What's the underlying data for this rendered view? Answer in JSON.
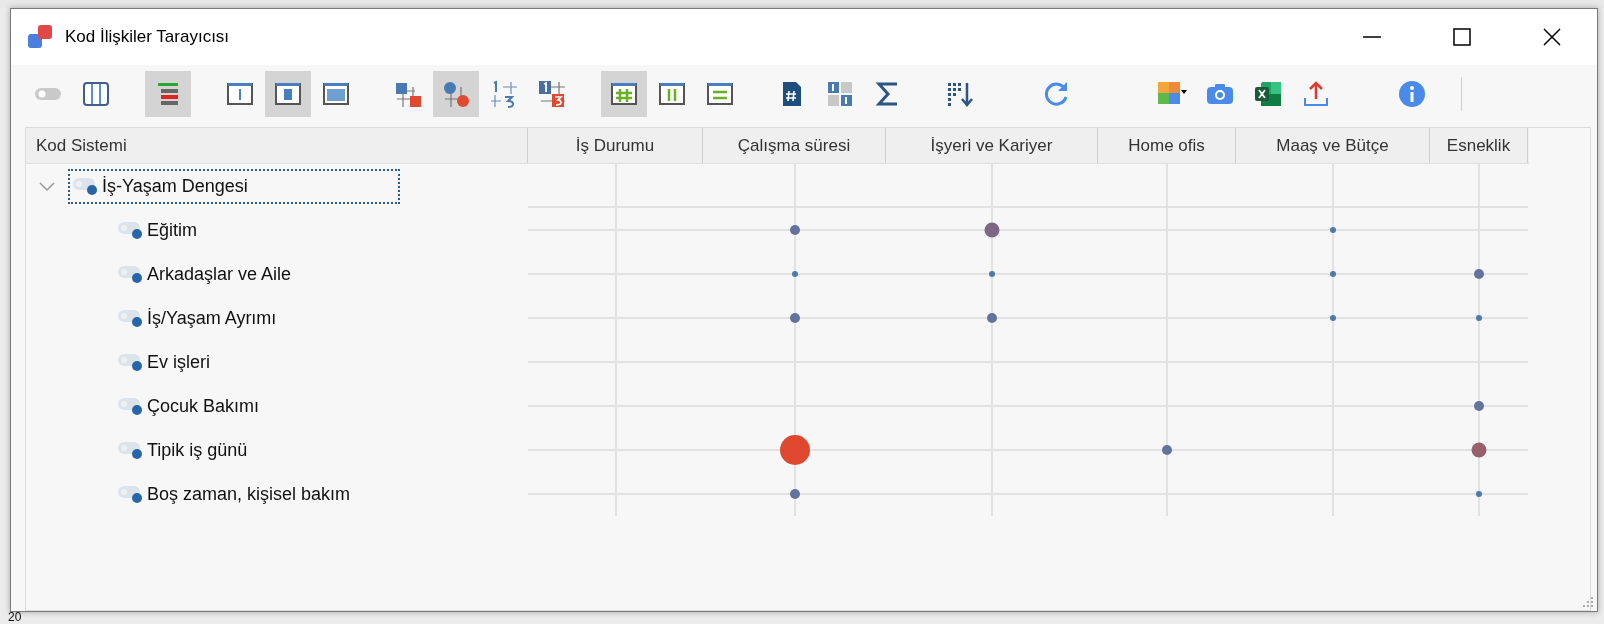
{
  "window": {
    "title": "Kod İlişkiler Tarayıcısı"
  },
  "toolbar": {
    "groups": [
      [
        {
          "selected": false
        },
        {
          "selected": false
        }
      ],
      [
        {
          "selected": true
        }
      ],
      [
        {
          "selected": false
        },
        {
          "selected": true
        },
        {
          "selected": false
        }
      ],
      [
        {
          "selected": false
        },
        {
          "selected": true
        },
        {
          "selected": false
        },
        {
          "selected": false
        }
      ],
      [
        {
          "selected": true
        },
        {
          "selected": false
        },
        {
          "selected": false
        }
      ],
      [
        {
          "selected": false
        },
        {
          "selected": false
        },
        {
          "selected": false
        }
      ],
      [
        {
          "selected": false
        }
      ],
      [
        {
          "selected": false
        }
      ],
      [
        {
          "selected": false
        },
        {
          "selected": false
        },
        {
          "selected": false
        },
        {
          "selected": false
        }
      ],
      [
        {
          "selected": false
        }
      ]
    ]
  },
  "table": {
    "first_column": "Kod Sistemi",
    "columns": [
      "İş Durumu",
      "Çalışma süresi",
      "İşyeri ve Kariyer",
      "Home ofis",
      "Maaş ve Bütçe",
      "Esneklik"
    ],
    "rows": [
      {
        "label": "İş-Yaşam Dengesi",
        "expanded": true,
        "focused": true,
        "cells": [
          null,
          null,
          null,
          null,
          null,
          null
        ],
        "children": [
          {
            "label": "Eğitim",
            "focused": false,
            "cells": [
              null,
              {
                "kind": "small",
                "color": "#63739c"
              },
              {
                "kind": "medium",
                "color": "#7c6884"
              },
              null,
              {
                "kind": "tiny",
                "color": "#4f79a8"
              },
              null
            ]
          },
          {
            "label": "Arkadaşlar ve Aile",
            "focused": false,
            "cells": [
              null,
              {
                "kind": "tiny",
                "color": "#4f79a8"
              },
              {
                "kind": "tiny",
                "color": "#4f79a8"
              },
              null,
              {
                "kind": "tiny",
                "color": "#4f79a8"
              },
              {
                "kind": "small",
                "color": "#63739c"
              }
            ]
          },
          {
            "label": "İş/Yaşam Ayrımı",
            "focused": false,
            "cells": [
              null,
              {
                "kind": "small",
                "color": "#63739c"
              },
              {
                "kind": "small",
                "color": "#63739c"
              },
              null,
              {
                "kind": "tiny",
                "color": "#4f79a8"
              },
              {
                "kind": "tiny",
                "color": "#4f79a8"
              }
            ]
          },
          {
            "label": "Ev işleri",
            "focused": false,
            "cells": [
              null,
              null,
              null,
              null,
              null,
              null
            ]
          },
          {
            "label": "Çocuk Bakımı",
            "focused": false,
            "cells": [
              null,
              null,
              null,
              null,
              null,
              {
                "kind": "small",
                "color": "#63739c"
              }
            ]
          },
          {
            "label": "Tipik iş günü",
            "focused": false,
            "cells": [
              null,
              {
                "kind": "xlarge",
                "color": "#e0472f"
              },
              null,
              {
                "kind": "small",
                "color": "#63739c"
              },
              null,
              {
                "kind": "medium",
                "color": "#98606d"
              }
            ]
          },
          {
            "label": "Boş zaman, kişisel bakım",
            "focused": false,
            "cells": [
              null,
              {
                "kind": "small",
                "color": "#63739c"
              },
              null,
              null,
              null,
              {
                "kind": "tiny",
                "color": "#4f79a8"
              }
            ]
          }
        ]
      }
    ]
  },
  "background_app": {
    "text": "20"
  }
}
